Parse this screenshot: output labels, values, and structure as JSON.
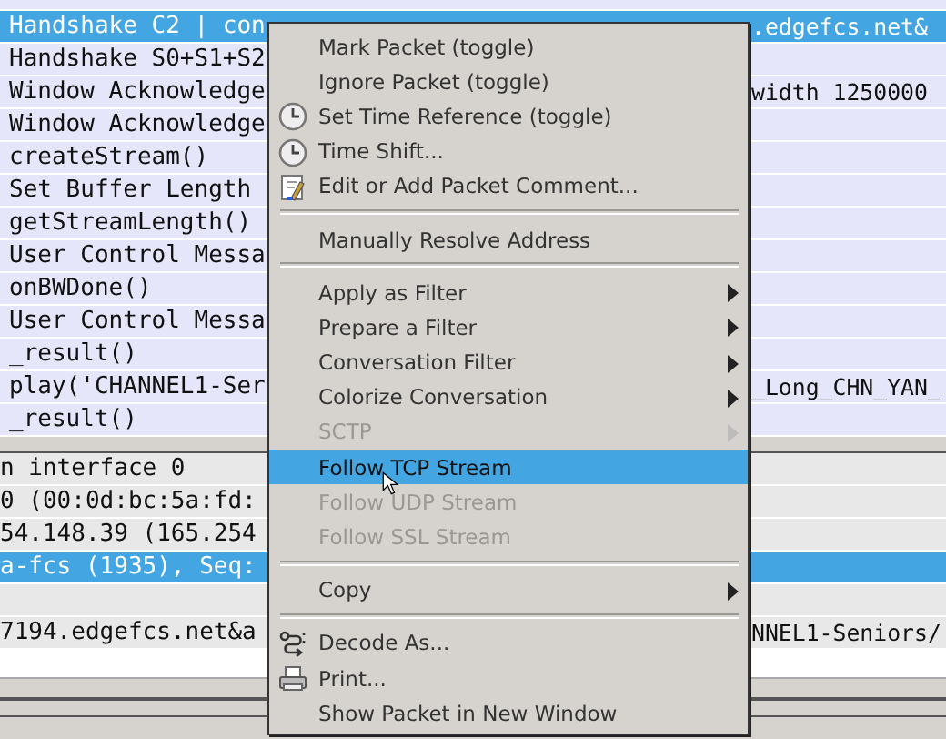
{
  "packet_list": {
    "rows": [
      {
        "left": "Handshake C2 | con",
        "right": ".edgefcs.net&",
        "selected": true
      },
      {
        "left": "Handshake S0+S1+S2",
        "right": "",
        "selected": false
      },
      {
        "left": "Window Acknowledge",
        "right": "width 1250000",
        "selected": false
      },
      {
        "left": "Window Acknowledge",
        "right": "",
        "selected": false
      },
      {
        "left": "createStream()",
        "right": "",
        "selected": false
      },
      {
        "left": "Set Buffer Length",
        "right": "",
        "selected": false
      },
      {
        "left": "getStreamLength()",
        "right": "",
        "selected": false
      },
      {
        "left": "User Control Messa",
        "right": "",
        "selected": false
      },
      {
        "left": "onBWDone()",
        "right": "",
        "selected": false
      },
      {
        "left": "User Control Messa",
        "right": "",
        "selected": false
      },
      {
        "left": "_result()",
        "right": "",
        "selected": false
      },
      {
        "left": "play('CHANNEL1-Ser",
        "right": "_Long_CHN_YAN_",
        "selected": false
      },
      {
        "left": "_result()",
        "right": "",
        "selected": false
      }
    ]
  },
  "packet_details": {
    "rows": [
      {
        "left": "n interface 0",
        "right": "",
        "selected": false
      },
      {
        "left": "0 (00:0d:bc:5a:fd:",
        "right": "",
        "selected": false
      },
      {
        "left": "54.148.39 (165.254",
        "right": "",
        "selected": false
      },
      {
        "left": "a-fcs (1935), Seq:",
        "right": "",
        "selected": true
      },
      {
        "left": "",
        "right": "",
        "selected": false
      },
      {
        "left": "7194.edgefcs.net&a",
        "right": "NNEL1-Seniors/",
        "selected": false
      }
    ]
  },
  "context_menu": {
    "items": [
      {
        "kind": "item",
        "label": "Mark Packet (toggle)",
        "submenu": false,
        "disabled": false,
        "selected": false
      },
      {
        "kind": "item",
        "label": "Ignore Packet (toggle)",
        "submenu": false,
        "disabled": false,
        "selected": false
      },
      {
        "kind": "item",
        "label": "Set Time Reference (toggle)",
        "submenu": false,
        "disabled": false,
        "selected": false
      },
      {
        "kind": "item",
        "label": "Time Shift...",
        "submenu": false,
        "disabled": false,
        "selected": false
      },
      {
        "kind": "item",
        "label": "Edit or Add Packet Comment...",
        "submenu": false,
        "disabled": false,
        "selected": false
      },
      {
        "kind": "separator"
      },
      {
        "kind": "item",
        "label": "Manually Resolve Address",
        "submenu": false,
        "disabled": false,
        "selected": false
      },
      {
        "kind": "separator"
      },
      {
        "kind": "item",
        "label": "Apply as Filter",
        "submenu": true,
        "disabled": false,
        "selected": false
      },
      {
        "kind": "item",
        "label": "Prepare a Filter",
        "submenu": true,
        "disabled": false,
        "selected": false
      },
      {
        "kind": "item",
        "label": "Conversation Filter",
        "submenu": true,
        "disabled": false,
        "selected": false
      },
      {
        "kind": "item",
        "label": "Colorize Conversation",
        "submenu": true,
        "disabled": false,
        "selected": false
      },
      {
        "kind": "item",
        "label": "SCTP",
        "submenu": true,
        "disabled": true,
        "selected": false
      },
      {
        "kind": "item",
        "label": "Follow TCP Stream",
        "submenu": false,
        "disabled": false,
        "selected": true
      },
      {
        "kind": "item",
        "label": "Follow UDP Stream",
        "submenu": false,
        "disabled": true,
        "selected": false
      },
      {
        "kind": "item",
        "label": "Follow SSL Stream",
        "submenu": false,
        "disabled": true,
        "selected": false
      },
      {
        "kind": "separator"
      },
      {
        "kind": "item",
        "label": "Copy",
        "submenu": true,
        "disabled": false,
        "selected": false
      },
      {
        "kind": "separator"
      },
      {
        "kind": "item",
        "label": "Decode As...",
        "submenu": false,
        "disabled": false,
        "selected": false
      },
      {
        "kind": "item",
        "label": "Print...",
        "submenu": false,
        "disabled": false,
        "selected": false
      },
      {
        "kind": "item",
        "label": "Show Packet in New Window",
        "submenu": false,
        "disabled": false,
        "selected": false
      }
    ]
  }
}
